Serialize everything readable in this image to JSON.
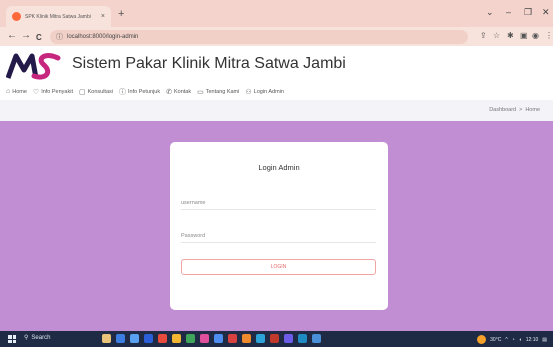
{
  "browser": {
    "tab_title": "SPK Klinik Mitra Satwa Jambi",
    "tab_close": "×",
    "new_tab": "+",
    "url": "localhost:8000/login-admin",
    "controls": {
      "chevron": "⌄",
      "minimize": "–",
      "maximize": "❐",
      "close": "✕"
    },
    "nav": {
      "back": "←",
      "forward": "→",
      "reload": "C"
    }
  },
  "site": {
    "logo_text": "MS",
    "title": "Sistem Pakar Klinik Mitra Satwa Jambi"
  },
  "menu": [
    {
      "label": "Home",
      "icon": "⌂"
    },
    {
      "label": "Info Penyakit",
      "icon": "♡"
    },
    {
      "label": "Konsultasi",
      "icon": "▢"
    },
    {
      "label": "Info Petunjuk",
      "icon": "ⓘ"
    },
    {
      "label": "Kontak",
      "icon": "✆"
    },
    {
      "label": "Tentang Kami",
      "icon": "▭"
    },
    {
      "label": "Login Admin",
      "icon": "⚇"
    }
  ],
  "breadcrumb": {
    "first": "Dashboard",
    "separator": ">",
    "current": "Home"
  },
  "login": {
    "title": "Login Admin",
    "username_placeholder": "username",
    "password_placeholder": "Password",
    "button_label": "LOGIN"
  },
  "taskbar": {
    "search_label": "Search",
    "weather": "30°C",
    "time": "12:10"
  },
  "colors": {
    "main_bg": "#c18ed3",
    "tab_strip": "#f3d3cc",
    "login_button_text": "#e86a6a"
  }
}
